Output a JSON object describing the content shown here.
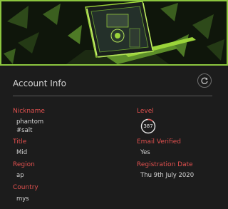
{
  "panel": {
    "title": "Account Info"
  },
  "fields": {
    "nickname": {
      "label": "Nickname",
      "value_line1": "phantom",
      "value_line2": "#salt"
    },
    "title": {
      "label": "Title",
      "value": "Mid"
    },
    "region": {
      "label": "Region",
      "value": "ap"
    },
    "country": {
      "label": "Country",
      "value": "mys"
    },
    "level": {
      "label": "Level",
      "value": "387",
      "progress_fraction": 0.1
    },
    "email_verified": {
      "label": "Email Verified",
      "value": "Yes"
    },
    "registration_date": {
      "label": "Registration Date",
      "value": "Thu 9th July 2020"
    }
  },
  "icons": {
    "refresh": "refresh-icon"
  },
  "colors": {
    "label": "#e0504e",
    "accent_green": "#9bd43a",
    "background": "#1c1c1c"
  }
}
